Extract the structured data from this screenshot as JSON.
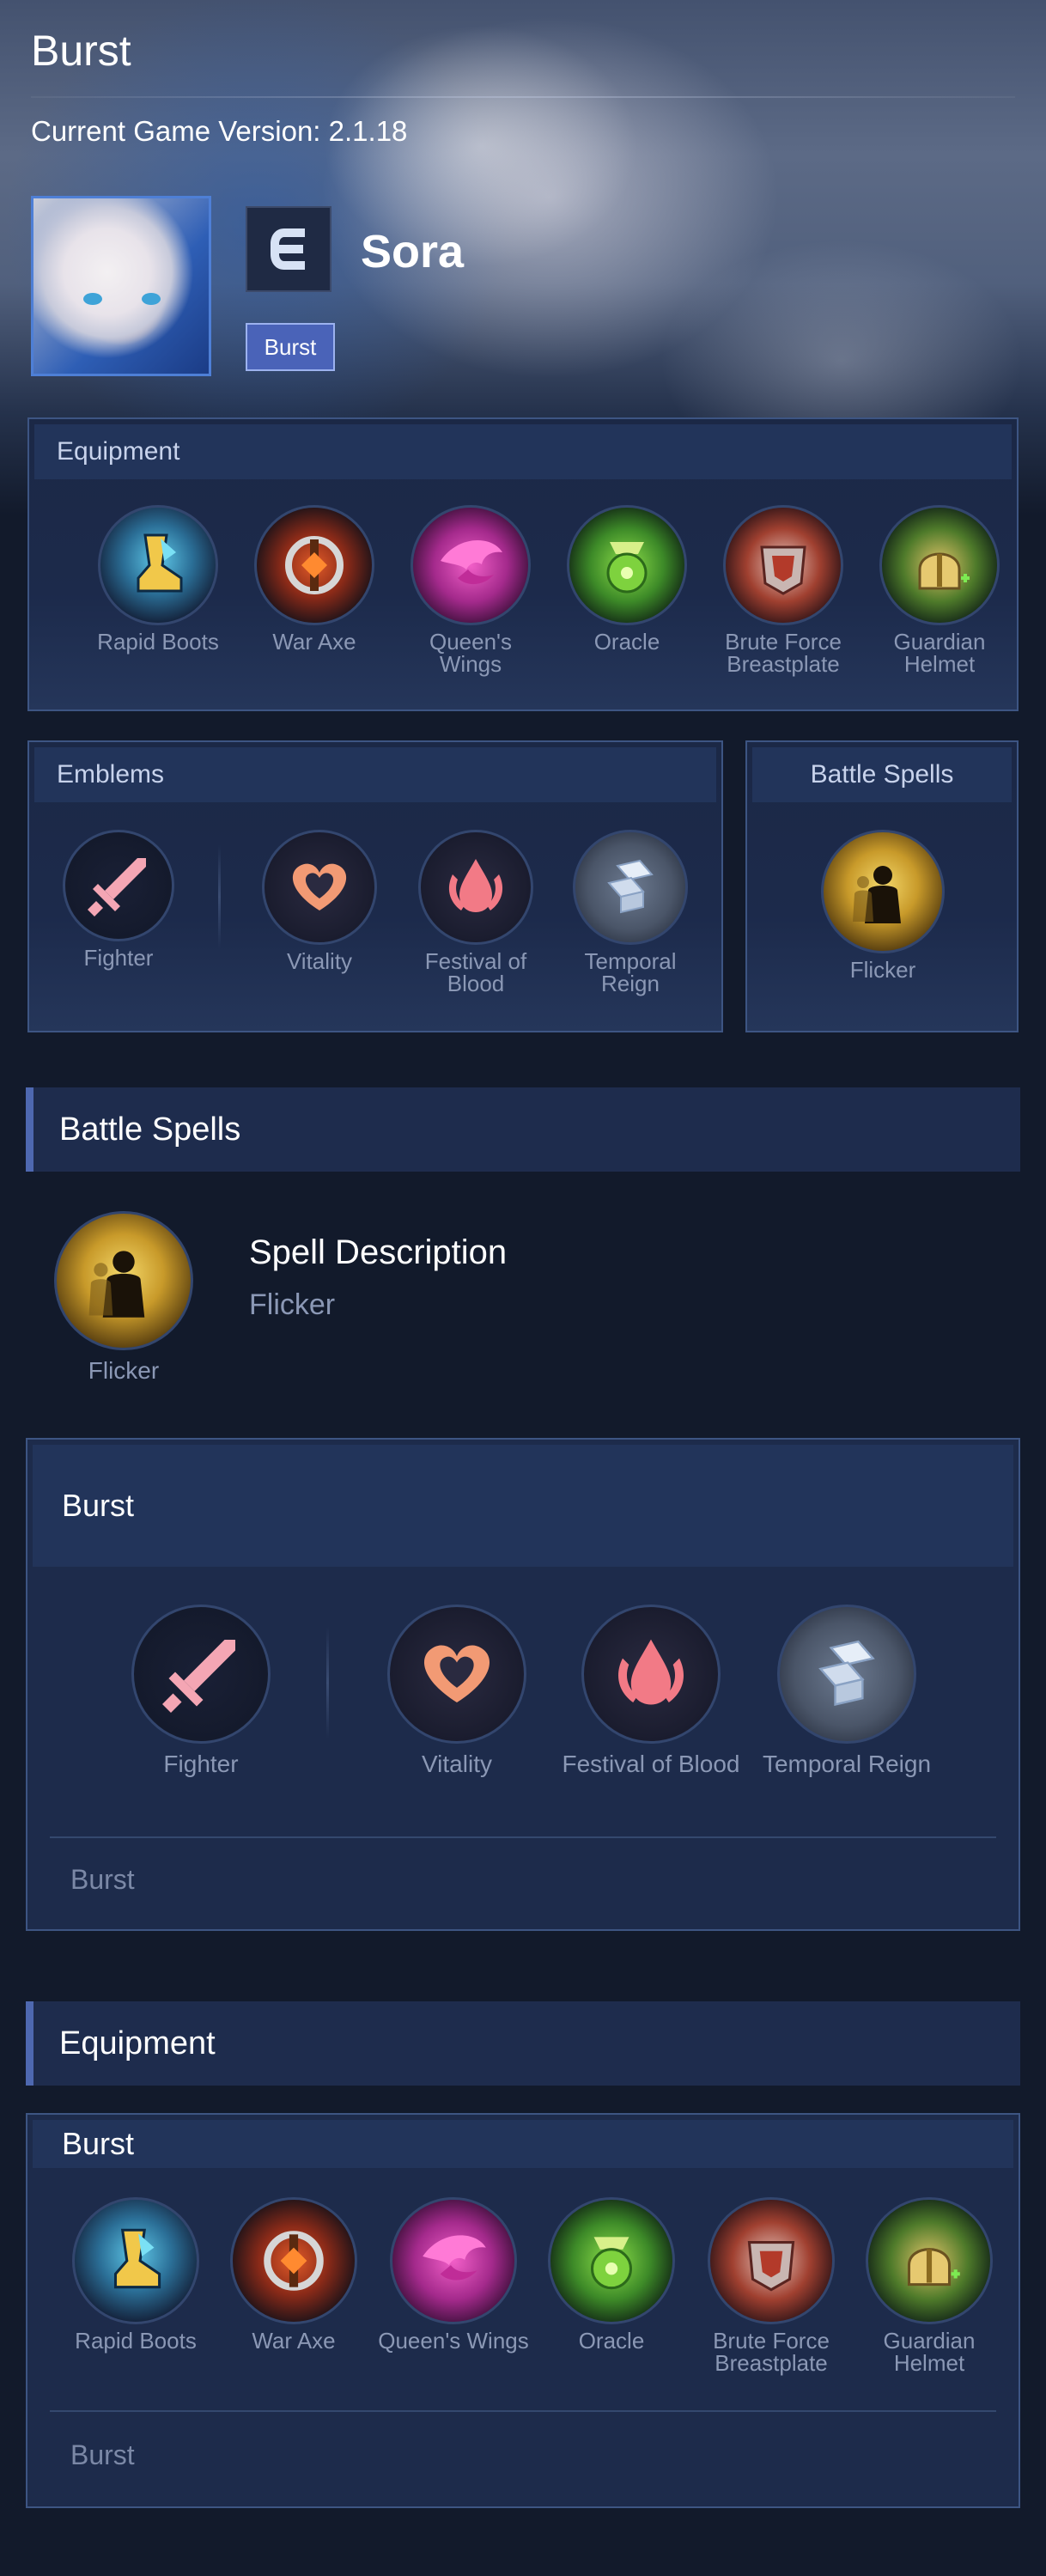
{
  "hero": {
    "title": "Burst",
    "version": "Current Game Version: 2.1.18",
    "name": "Sora",
    "tag": "Burst"
  },
  "equipment_panel": {
    "header": "Equipment",
    "items": [
      {
        "label": "Rapid Boots"
      },
      {
        "label": "War Axe"
      },
      {
        "label": "Queen's Wings"
      },
      {
        "label": "Oracle"
      },
      {
        "label": "Brute Force Breastplate"
      },
      {
        "label": "Guardian Helmet"
      }
    ]
  },
  "emblems_panel": {
    "header": "Emblems",
    "main": "Fighter",
    "talents": [
      "Vitality",
      "Festival of Blood",
      "Temporal Reign"
    ]
  },
  "spells_panel": {
    "header": "Battle Spells",
    "spell": "Flicker"
  },
  "battle_spells_section": {
    "title": "Battle Spells",
    "spell_label": "Flicker",
    "desc_title": "Spell Description",
    "desc_text": "Flicker"
  },
  "burst_emblem_card": {
    "header": "Burst",
    "main": "Fighter",
    "talents": [
      "Vitality",
      "Festival of Blood",
      "Temporal Reign"
    ],
    "footer": "Burst"
  },
  "equipment_section": {
    "title": "Equipment",
    "build_header": "Burst",
    "items": [
      {
        "label": "Rapid Boots"
      },
      {
        "label": "War Axe"
      },
      {
        "label": "Queen's Wings"
      },
      {
        "label": "Oracle"
      },
      {
        "label": "Brute Force Breastplate"
      },
      {
        "label": "Guardian Helmet"
      }
    ],
    "footer": "Burst"
  },
  "colors": {
    "accent": "#4e68b0",
    "panel_border": "#3d5583",
    "tag_bg": "#4a63b8"
  }
}
